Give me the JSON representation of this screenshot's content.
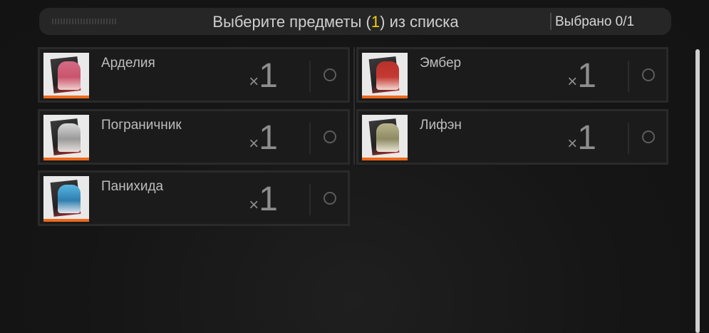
{
  "header": {
    "title_prefix": "Выберите предметы (",
    "title_count": "1",
    "title_suffix": ") из списка",
    "selected_label": "Выбрано 0/1"
  },
  "items": [
    {
      "name": "Арделия",
      "qty_prefix": "×",
      "qty": "1",
      "portrait_color": "#c9556b",
      "hair_color": "#d46a86"
    },
    {
      "name": "Эмбер",
      "qty_prefix": "×",
      "qty": "1",
      "portrait_color": "#c43a33",
      "hair_color": "#b8302a"
    },
    {
      "name": "Пограничник",
      "qty_prefix": "×",
      "qty": "1",
      "portrait_color": "#9a9a9a",
      "hair_color": "#d8d8d8"
    },
    {
      "name": "Лифэн",
      "qty_prefix": "×",
      "qty": "1",
      "portrait_color": "#8e8a64",
      "hair_color": "#b9b48a"
    },
    {
      "name": "Панихида",
      "qty_prefix": "×",
      "qty": "1",
      "portrait_color": "#2f7fb0",
      "hair_color": "#58b5e0"
    }
  ],
  "colors": {
    "accent_yellow": "#f2d200",
    "stripe_orange": "#ef6a1b"
  }
}
